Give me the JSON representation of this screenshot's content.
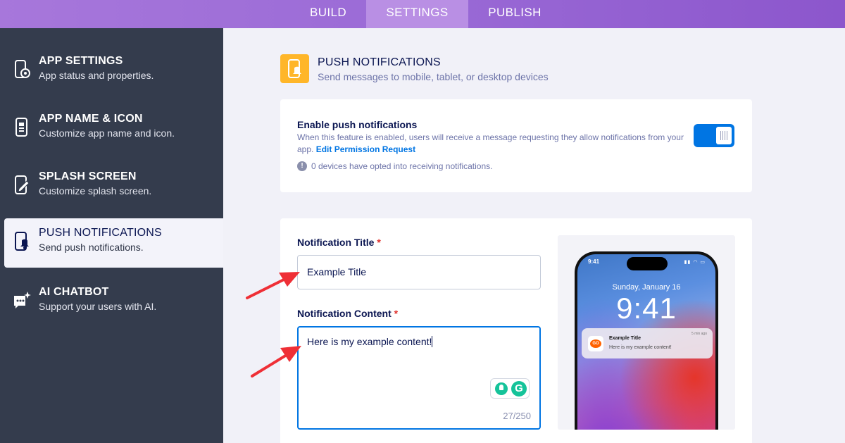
{
  "top_tabs": [
    {
      "label": "BUILD",
      "active": false
    },
    {
      "label": "SETTINGS",
      "active": true
    },
    {
      "label": "PUBLISH",
      "active": false
    }
  ],
  "sidebar": {
    "items": [
      {
        "title": "APP SETTINGS",
        "desc": "App status and properties.",
        "icon": "phone-gear-icon"
      },
      {
        "title": "APP NAME & ICON",
        "desc": "Customize app name and icon.",
        "icon": "phone-card-icon"
      },
      {
        "title": "SPLASH SCREEN",
        "desc": "Customize splash screen.",
        "icon": "phone-pencil-icon"
      },
      {
        "title": "PUSH NOTIFICATIONS",
        "desc": "Send push notifications.",
        "icon": "phone-bell-icon",
        "active": true
      },
      {
        "title": "AI CHATBOT",
        "desc": "Support your users with AI.",
        "icon": "chat-sparkle-icon"
      }
    ]
  },
  "header": {
    "title": "PUSH NOTIFICATIONS",
    "subtitle": "Send messages to mobile, tablet, or desktop devices",
    "icon": "phone-bell-icon",
    "icon_color": "#ffb629"
  },
  "enable_card": {
    "title": "Enable push notifications",
    "desc": "When this feature is enabled, users will receive a message requesting they allow notifications from your app.",
    "link": "Edit Permission Request",
    "info": "0 devices have opted into receiving notifications.",
    "toggle_on": true
  },
  "form": {
    "title_label": "Notification Title",
    "title_value": "Example Title",
    "content_label": "Notification Content",
    "content_value": "Here is my example content!",
    "counter": "27/250",
    "required_mark": "*"
  },
  "preview": {
    "status_time": "9:41",
    "status_icons": "▮▮ ◠ ▭",
    "date": "Sunday, January 16",
    "clock": "9:41",
    "notif_title": "Example Title",
    "notif_body": "Here is my example content!",
    "notif_ago": "5 min ago"
  },
  "colors": {
    "accent": "#0075e3",
    "sidebar_bg": "#343c4d",
    "topbar": "#9a6ad6",
    "arrow": "#ef2f36"
  }
}
